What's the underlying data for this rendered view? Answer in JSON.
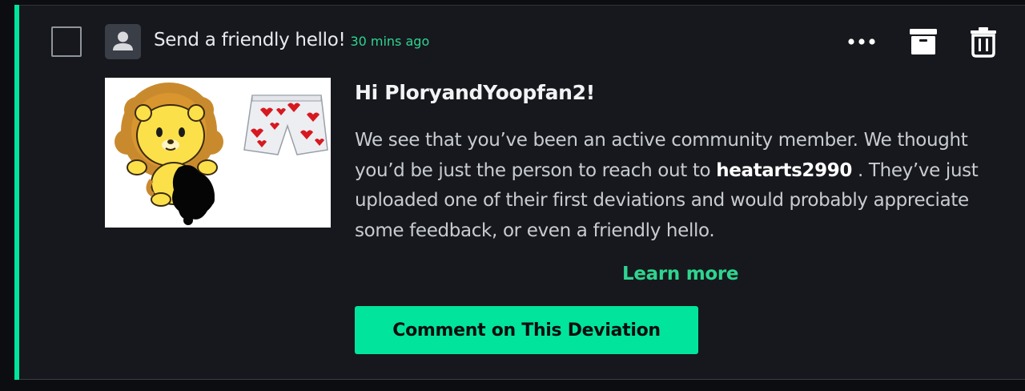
{
  "notification": {
    "title": "Send a friendly hello!",
    "timestamp": "30 mins ago",
    "greeting": "Hi PloryandYoopfan2!",
    "message_part1": "We see that you’ve been an active community member. We thought you’d be just the person to reach out to ",
    "username": "heatarts2990",
    "message_part2": " . They’ve just uploaded one of their first deviations and would probably appreciate some feedback, or even a friendly hello.",
    "learn_more_label": "Learn more",
    "cta_label": "Comment on This Deviation"
  },
  "icons": {
    "avatar": "user-avatar-icon",
    "more": "more-options-icon",
    "archive": "archive-icon",
    "delete": "trash-icon"
  },
  "colors": {
    "accent": "#00e59b",
    "background": "#16181d",
    "timestamp": "#2fd48f"
  }
}
